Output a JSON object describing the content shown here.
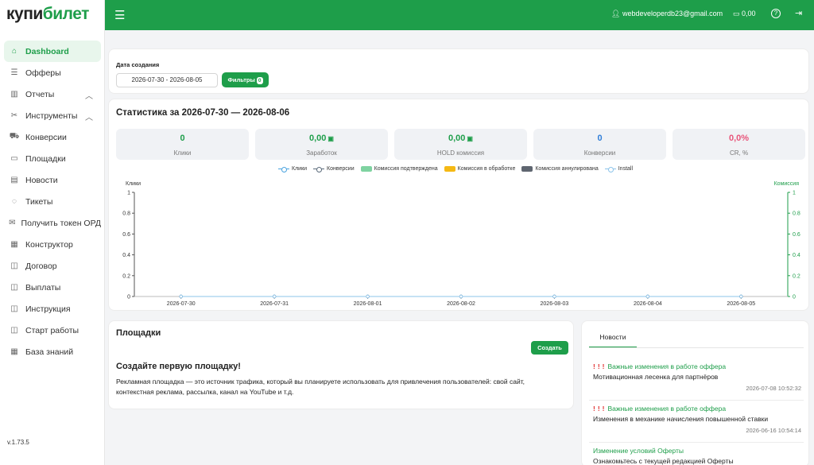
{
  "brand": {
    "logo_part1": "купи",
    "logo_part2": "билет"
  },
  "sidebar": {
    "items": [
      {
        "label": "Dashboard",
        "icon": "home-icon",
        "glyph": "⌂",
        "active": true
      },
      {
        "label": "Офферы",
        "icon": "list-icon",
        "glyph": "☰"
      },
      {
        "label": "Отчеты",
        "icon": "chart-icon",
        "glyph": "▥",
        "chevron": true
      },
      {
        "label": "Инструменты",
        "icon": "tools-icon",
        "glyph": "✂",
        "chevron": true
      },
      {
        "label": "Конверсии",
        "icon": "cart-icon",
        "glyph": "⛟"
      },
      {
        "label": "Площадки",
        "icon": "window-icon",
        "glyph": "▭"
      },
      {
        "label": "Новости",
        "icon": "news-icon",
        "glyph": "▤"
      },
      {
        "label": "Тикеты",
        "icon": "chat-icon",
        "glyph": "◌"
      },
      {
        "label": "Получить токен ОРД",
        "icon": "mail-icon",
        "glyph": "✉"
      },
      {
        "label": "Конструктор",
        "icon": "grid-icon",
        "glyph": "▦"
      },
      {
        "label": "Договор",
        "icon": "book-icon",
        "glyph": "◫"
      },
      {
        "label": "Выплаты",
        "icon": "book-icon",
        "glyph": "◫"
      },
      {
        "label": "Инструкция",
        "icon": "book-icon",
        "glyph": "◫"
      },
      {
        "label": "Старт работы",
        "icon": "book-icon",
        "glyph": "◫"
      },
      {
        "label": "База знаний",
        "icon": "grid-icon",
        "glyph": "▦"
      }
    ],
    "version": "v.1.73.5"
  },
  "header": {
    "email": "webdeveloperdb23@gmail.com",
    "balance": "0,00"
  },
  "filters": {
    "date_label": "Дата создания",
    "date_range": "2026-07-30 - 2026-08-05",
    "button_label": "Фильтры",
    "button_badge": "0"
  },
  "stats": {
    "title": "Статистика за 2026-07-30 — 2026-08-06",
    "kpis": [
      {
        "value": "0",
        "label": "Клики",
        "color": "#1e9e4a",
        "money": false
      },
      {
        "value": "0,00",
        "label": "Заработок",
        "color": "#1e9e4a",
        "money": true
      },
      {
        "value": "0,00",
        "label": "HOLD комиссия",
        "color": "#1e9e4a",
        "money": true
      },
      {
        "value": "0",
        "label": "Конверсии",
        "color": "#2f7ed8",
        "money": false
      },
      {
        "value": "0,0%",
        "label": "CR, %",
        "color": "#e8557a",
        "money": false
      }
    ]
  },
  "colors": {
    "accent": "#1e9e4a",
    "clicks": "#4aa3df",
    "conversions": "#5b6b7b",
    "approved": "#7fd3a1",
    "pending": "#f5b914",
    "cancelled": "#5f6670",
    "install": "#8cc4ea"
  },
  "chart_data": {
    "type": "line",
    "ylabel": "Клики",
    "y2label": "Комиссия",
    "categories": [
      "2026-07-30",
      "2026-07-31",
      "2026-08-01",
      "2026-08-02",
      "2026-08-03",
      "2026-08-04",
      "2026-08-05"
    ],
    "series": [
      {
        "name": "Клики",
        "kind": "line",
        "values": [
          0,
          0,
          0,
          0,
          0,
          0,
          0
        ]
      },
      {
        "name": "Конверсии",
        "kind": "line",
        "values": [
          0,
          0,
          0,
          0,
          0,
          0,
          0
        ]
      },
      {
        "name": "Комиссия подтверждена",
        "kind": "bar",
        "values": [
          0,
          0,
          0,
          0,
          0,
          0,
          0
        ]
      },
      {
        "name": "Комиссия в обработке",
        "kind": "bar",
        "values": [
          0,
          0,
          0,
          0,
          0,
          0,
          0
        ]
      },
      {
        "name": "Комиссия аннулирована",
        "kind": "bar",
        "values": [
          0,
          0,
          0,
          0,
          0,
          0,
          0
        ]
      },
      {
        "name": "Install",
        "kind": "line",
        "values": [
          0,
          0,
          0,
          0,
          0,
          0,
          0
        ]
      }
    ],
    "yticks": [
      "0",
      "0.2",
      "0.4",
      "0.6",
      "0.8",
      "1"
    ],
    "ylim": [
      0,
      1
    ],
    "y2lim": [
      0,
      1
    ],
    "legend_position": "top"
  },
  "ploshadki": {
    "title": "Площадки",
    "create_button": "Создать",
    "heading": "Создайте первую площадку!",
    "text": "Рекламная площадка — это источник трафика, который вы планируете использовать для привлечения пользователей: свой сайт, контекстная реклама, рассылка, канал на YouTube и т.д."
  },
  "news": {
    "tab_label": "Новости",
    "items": [
      {
        "important": true,
        "title": "Важные изменения в работе оффера",
        "subtitle": "Мотивационная лесенка для партнёров",
        "date": "2026-07-08 10:52:32"
      },
      {
        "important": true,
        "title": "Важные изменения в работе оффера",
        "subtitle": "Изменения в механике начисления повышенной ставки",
        "date": "2026-06-16 10:54:14"
      },
      {
        "important": false,
        "title": "Изменение условий Оферты",
        "subtitle": "Ознакомьтесь с текущей редакцией Оферты",
        "date": ""
      }
    ]
  }
}
